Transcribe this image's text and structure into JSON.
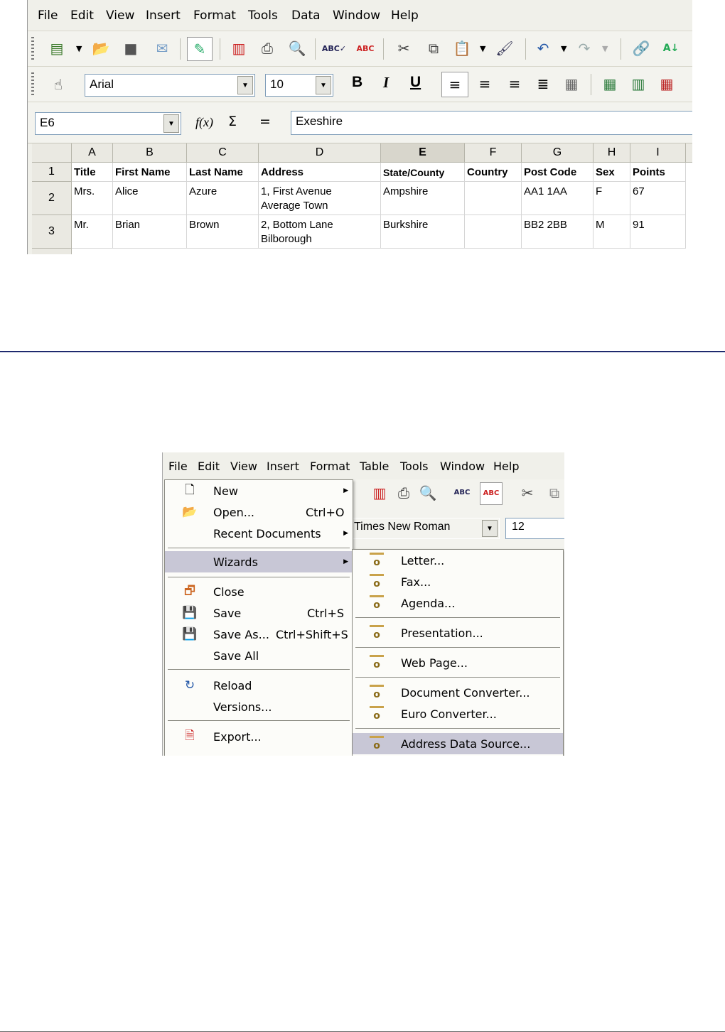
{
  "calc": {
    "menu": [
      "File",
      "Edit",
      "View",
      "Insert",
      "Format",
      "Tools",
      "Data",
      "Window",
      "Help"
    ],
    "font_name": "Arial",
    "font_size": "10",
    "cell_ref": "E6",
    "formula_value": "Exeshire",
    "fx_label": "f(x)",
    "sum_label": "Σ",
    "eq_label": "=",
    "bold": "B",
    "italic": "I",
    "underline": "U",
    "columns": [
      "A",
      "B",
      "C",
      "D",
      "E",
      "F",
      "G",
      "H",
      "I"
    ],
    "rows": [
      {
        "num": "1",
        "cells": [
          "Title",
          "First Name",
          "Last Name",
          "Address",
          "State/County",
          "Country",
          "Post Code",
          "Sex",
          "Points"
        ]
      },
      {
        "num": "2",
        "cells": [
          "Mrs.",
          "Alice",
          "Azure",
          "1, First Avenue",
          "Ampshire",
          "",
          "AA1 1AA",
          "F",
          "67"
        ],
        "address2": "Average Town"
      },
      {
        "num": "3",
        "cells": [
          "Mr.",
          "Brian",
          "Brown",
          "2, Bottom Lane",
          "Burkshire",
          "",
          "BB2 2BB",
          "M",
          "91"
        ],
        "address2": "Bilborough"
      }
    ]
  },
  "writer": {
    "menu": [
      "File",
      "Edit",
      "View",
      "Insert",
      "Format",
      "Table",
      "Tools",
      "Window",
      "Help"
    ],
    "font_name": "Times New Roman",
    "font_size": "12",
    "file_menu": {
      "new": "New",
      "open": "Open...",
      "open_acc": "Ctrl+O",
      "recent": "Recent Documents",
      "wizards": "Wizards",
      "close": "Close",
      "save": "Save",
      "save_acc": "Ctrl+S",
      "save_as": "Save As...",
      "save_as_acc": "Ctrl+Shift+S",
      "save_all": "Save All",
      "reload": "Reload",
      "versions": "Versions...",
      "export": "Export..."
    },
    "wizards_menu": {
      "letter": "Letter...",
      "fax": "Fax...",
      "agenda": "Agenda...",
      "presentation": "Presentation...",
      "web_page": "Web Page...",
      "doc_converter": "Document Converter...",
      "euro_converter": "Euro Converter...",
      "address_source": "Address Data Source..."
    }
  }
}
